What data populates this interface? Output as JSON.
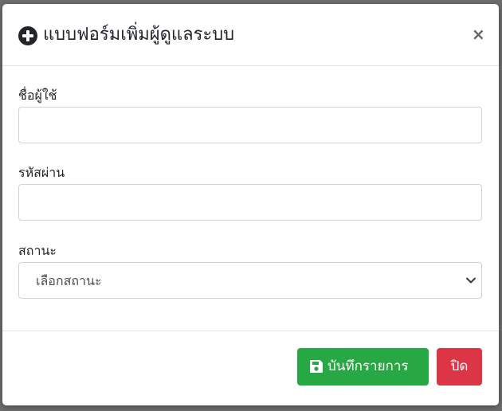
{
  "modal": {
    "title": "แบบฟอร์มเพิ่มผู้ดูแลระบบ",
    "close_symbol": "×",
    "icons": {
      "title_icon": "plus-circle-icon",
      "save_icon": "floppy-disk-icon",
      "select_icon": "chevron-down-icon"
    },
    "fields": {
      "username": {
        "label": "ชื่อผู้ใช้",
        "value": ""
      },
      "password": {
        "label": "รหัสผ่าน",
        "value": ""
      },
      "status": {
        "label": "สถานะ",
        "selected": "เลือกสถานะ"
      }
    },
    "buttons": {
      "save_label": "บันทึกรายการ",
      "close_label": "ปิด"
    },
    "colors": {
      "save_button": "#28a745",
      "close_button": "#dc3545",
      "backdrop": "#6d6d6d"
    }
  }
}
